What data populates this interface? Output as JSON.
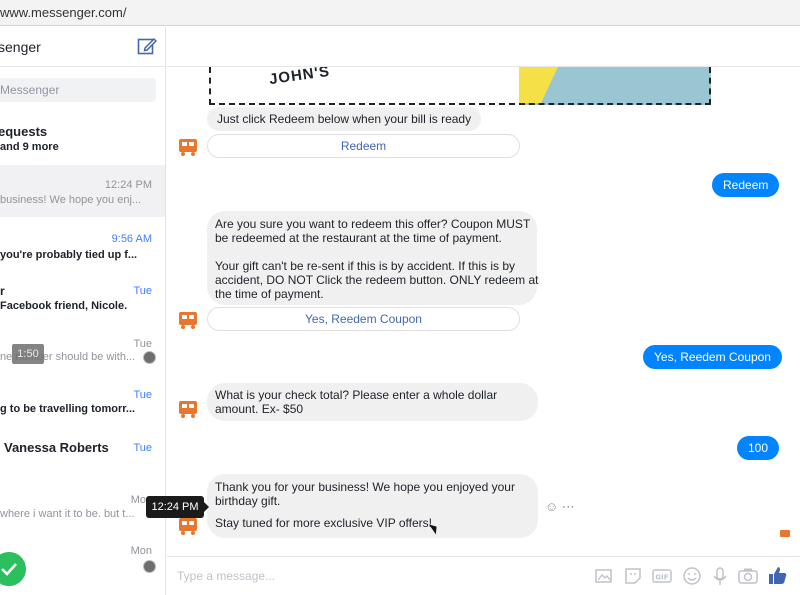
{
  "browser": {
    "url": "www.messenger.com/"
  },
  "sidebar": {
    "title": "senger",
    "search_placeholder": "Messenger",
    "requests_title": "equests",
    "requests_more": "and 9 more",
    "badge": "1:50",
    "conversations": [
      {
        "time": "12:24 PM",
        "time_unread": false,
        "name": "",
        "snippet": "business! We hope you enj...",
        "snippet_bold": false,
        "active": true
      },
      {
        "time": "9:56 AM",
        "time_unread": true,
        "name": "",
        "snippet": "you're probably tied up f...",
        "snippet_bold": true,
        "active": false
      },
      {
        "time": "Tue",
        "time_unread": true,
        "name": "r",
        "snippet": "Facebook friend, Nicole.",
        "snippet_bold": true,
        "active": false
      },
      {
        "time": "Tue",
        "time_unread": false,
        "name": "",
        "snippet": "ne number should be with...",
        "snippet_bold": false,
        "active": false
      },
      {
        "time": "Tue",
        "time_unread": true,
        "name": "",
        "snippet": "g to be travelling tomorr...",
        "snippet_bold": true,
        "active": false
      },
      {
        "time": "Tue",
        "time_unread": true,
        "name": "Vanessa Roberts",
        "snippet": "",
        "snippet_bold": false,
        "active": false
      },
      {
        "time": "Mo",
        "time_unread": false,
        "name": "",
        "snippet": "where i want it to be. but t...",
        "snippet_bold": false,
        "active": false
      },
      {
        "time": "Mon",
        "time_unread": false,
        "name": "",
        "snippet": "",
        "snippet_bold": false,
        "active": false
      }
    ]
  },
  "chat": {
    "coupon_logo": "JOHN'S",
    "msg_redeem_prompt": "Just click Redeem below when your bill is ready",
    "btn_redeem": "Redeem",
    "out_redeem": "Redeem",
    "msg_confirm": {
      "p1": [
        "Are you sure you want to redeem this offer? Coupon MUST",
        "be redeemed at the restaurant at the time of payment."
      ],
      "p2": [
        "Your gift can't be re-sent if this is by accident. If this is by",
        "accident, DO NOT Click the redeem button. ONLY redeem at",
        "the time of payment."
      ]
    },
    "btn_yes": "Yes, Reedem Coupon",
    "out_yes": "Yes, Reedem Coupon",
    "msg_check": [
      "What is your check total? Please enter a whole dollar",
      "amount. Ex- $50"
    ],
    "out_amount": "100",
    "msg_thanks": {
      "p1": [
        "Thank you for your business! We hope you enjoyed your",
        "birthday gift."
      ],
      "p2": [
        "Stay tuned for more exclusive VIP offers!"
      ]
    },
    "tooltip_time": "12:24 PM",
    "composer_placeholder": "Type a message..."
  },
  "colors": {
    "accent": "#0084ff",
    "link": "#4267b2",
    "unread": "#4080ff",
    "bubble_in": "#f1f0f0",
    "bot_icon": "#e8762c"
  }
}
